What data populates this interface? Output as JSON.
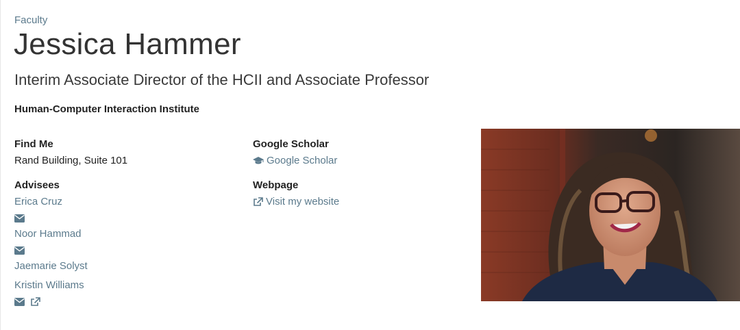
{
  "breadcrumb": "Faculty",
  "profile": {
    "name": "Jessica Hammer",
    "title": "Interim Associate Director of the HCII and Associate Professor",
    "department": "Human-Computer Interaction Institute"
  },
  "find_me": {
    "label": "Find Me",
    "location": "Rand Building, Suite 101"
  },
  "advisees": {
    "label": "Advisees",
    "names": [
      "Erica Cruz",
      "Noor Hammad",
      "Jaemarie Solyst",
      "Kristin Williams"
    ]
  },
  "google_scholar": {
    "label": "Google Scholar",
    "link_text": "Google Scholar",
    "icon": "graduation-cap-icon"
  },
  "webpage": {
    "label": "Webpage",
    "link_text": "Visit my website",
    "icon": "external-link-icon"
  },
  "colors": {
    "link": "#5b7a8c",
    "text": "#222222",
    "heading": "#333333"
  }
}
